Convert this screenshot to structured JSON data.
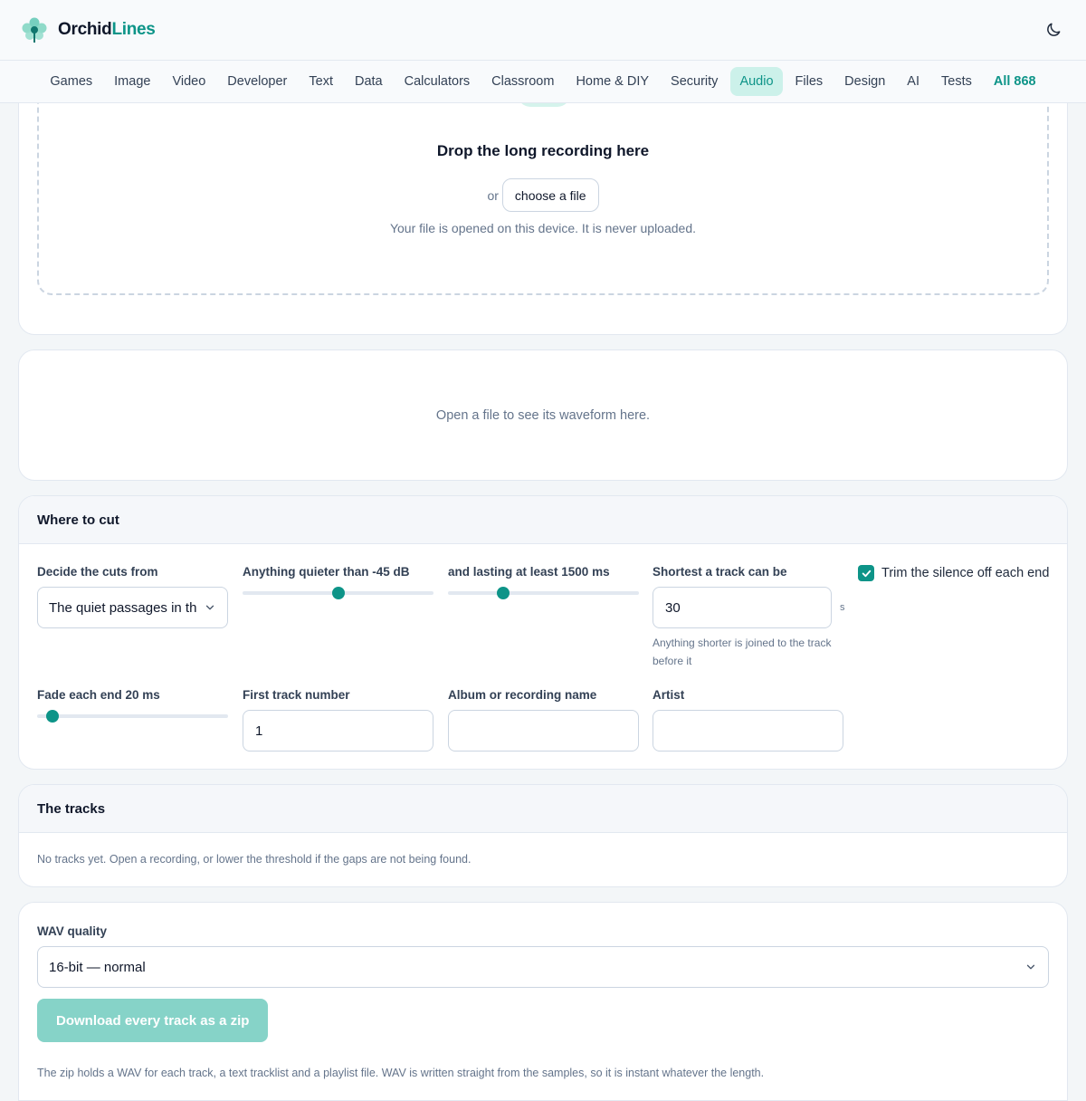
{
  "brand": {
    "name_part1": "Orchid",
    "name_part2": "Lines"
  },
  "nav": {
    "items": [
      {
        "label": "Games"
      },
      {
        "label": "Image"
      },
      {
        "label": "Video"
      },
      {
        "label": "Developer"
      },
      {
        "label": "Text"
      },
      {
        "label": "Data"
      },
      {
        "label": "Calculators"
      },
      {
        "label": "Classroom"
      },
      {
        "label": "Home & DIY"
      },
      {
        "label": "Security"
      },
      {
        "label": "Audio"
      },
      {
        "label": "Files"
      },
      {
        "label": "Design"
      },
      {
        "label": "AI"
      },
      {
        "label": "Tests"
      }
    ],
    "all_label": "All 868",
    "active": "Audio"
  },
  "drop": {
    "title": "Drop the long recording here",
    "or_text": "or",
    "choose_label": "choose a file",
    "note": "Your file is opened on this device. It is never uploaded."
  },
  "waveform": {
    "empty_text": "Open a file to see its waveform here."
  },
  "cut": {
    "heading": "Where to cut",
    "decide": {
      "label": "Decide the cuts from",
      "value": "The quiet passages in the recording"
    },
    "threshold": {
      "label": "Anything quieter than -45 dB",
      "fraction": 0.5
    },
    "duration": {
      "label": "and lasting at least 1500 ms",
      "fraction": 0.29
    },
    "shortest": {
      "label": "Shortest a track can be",
      "value": "30",
      "unit": "s",
      "hint": "Anything shorter is joined to the track before it"
    },
    "trim": {
      "label": "Trim the silence off each end",
      "checked": true
    },
    "fade": {
      "label": "Fade each end 20 ms",
      "fraction": 0.08
    },
    "first_track": {
      "label": "First track number",
      "value": "1"
    },
    "album": {
      "label": "Album or recording name",
      "value": ""
    },
    "artist": {
      "label": "Artist",
      "value": ""
    }
  },
  "tracks": {
    "heading": "The tracks",
    "empty_text": "No tracks yet. Open a recording, or lower the threshold if the gaps are not being found."
  },
  "download": {
    "quality_label": "WAV quality",
    "quality_value": "16-bit — normal",
    "button_label": "Download every track as a zip",
    "note": "The zip holds a WAV for each track, a text tracklist and a playlist file. WAV is written straight from the samples, so it is instant whatever the length."
  },
  "colors": {
    "accent": "#0d9488",
    "accent_soft": "#ccf1ea",
    "button_disabled": "#86d3c8"
  },
  "icons": {
    "logo": "orchid-logo-icon",
    "theme": "moon-icon",
    "upload": "upload-tray-icon",
    "chevron": "chevron-down-icon",
    "check": "check-icon"
  }
}
